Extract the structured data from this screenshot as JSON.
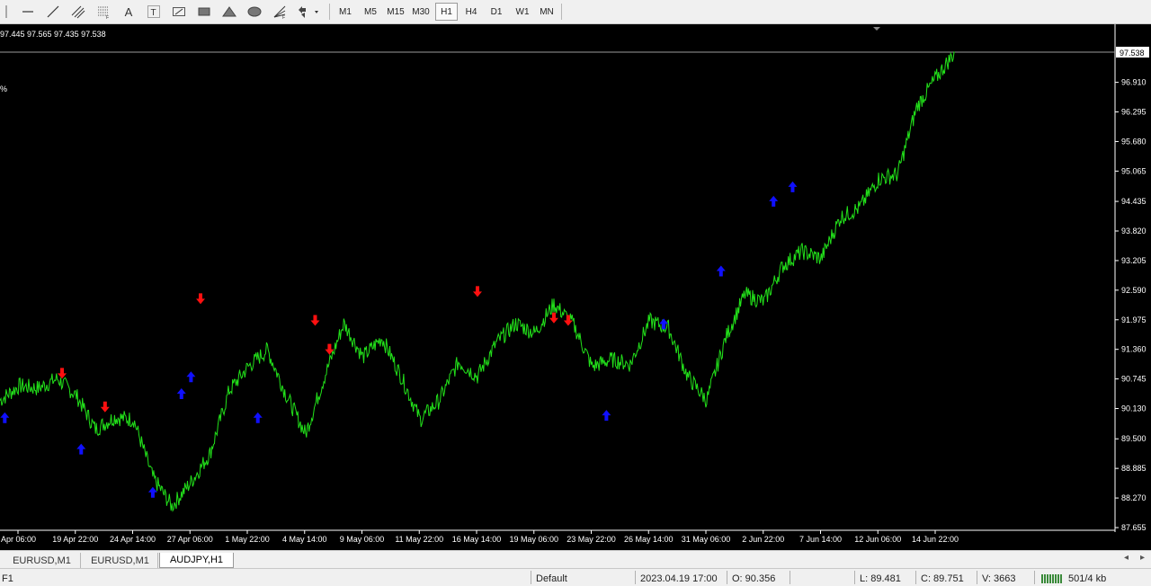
{
  "toolbar": {
    "tools": [
      {
        "name": "horizontal-line-icon"
      },
      {
        "name": "trend-line-icon"
      },
      {
        "name": "equidistant-channel-icon"
      },
      {
        "name": "fibonacci-icon"
      },
      {
        "name": "text-icon",
        "glyph": "A"
      },
      {
        "name": "text-label-icon",
        "glyph": "T"
      },
      {
        "name": "arrow-icon"
      },
      {
        "name": "rectangle-icon"
      },
      {
        "name": "triangle-icon"
      },
      {
        "name": "ellipse-icon"
      },
      {
        "name": "fibo-fan-icon"
      },
      {
        "name": "arrows-dropdown-icon"
      }
    ],
    "timeframes": [
      "M1",
      "M5",
      "M15",
      "M30",
      "H1",
      "H4",
      "D1",
      "W1",
      "MN"
    ],
    "active_timeframe": "H1"
  },
  "chart": {
    "ohlc_text": "97.445 97.565 97.435 97.538",
    "percent_text": "%",
    "current_price": "97.538",
    "colors": {
      "background": "#000000",
      "line": "#22e01a",
      "up_arrow": "#1010ff",
      "down_arrow": "#ff1010",
      "axis": "#ffffff"
    }
  },
  "chart_data": {
    "type": "line",
    "price_ticks": [
      "97.538",
      "96.910",
      "96.295",
      "95.680",
      "95.065",
      "94.435",
      "93.820",
      "93.205",
      "92.590",
      "91.975",
      "91.360",
      "90.745",
      "90.130",
      "89.500",
      "88.885",
      "88.270",
      "87.655"
    ],
    "time_ticks": [
      "Apr 06:00",
      "19 Apr 22:00",
      "24 Apr 14:00",
      "27 Apr 06:00",
      "1 May 22:00",
      "4 May 14:00",
      "9 May 06:00",
      "11 May 22:00",
      "16 May 14:00",
      "19 May 06:00",
      "23 May 22:00",
      "26 May 14:00",
      "31 May 06:00",
      "2 Jun 22:00",
      "7 Jun 14:00",
      "12 Jun 06:00",
      "14 Jun 22:00"
    ],
    "ylim": [
      87.655,
      97.538
    ],
    "series": [
      {
        "x": [
          0,
          0.02,
          0.04,
          0.06,
          0.08,
          0.1,
          0.12,
          0.14,
          0.16,
          0.18,
          0.2,
          0.22,
          0.24,
          0.26,
          0.28,
          0.3,
          0.32,
          0.34,
          0.36,
          0.38,
          0.4,
          0.42,
          0.44,
          0.46,
          0.48,
          0.5,
          0.52,
          0.54,
          0.56,
          0.58,
          0.6,
          0.62,
          0.64,
          0.66,
          0.68,
          0.7,
          0.72,
          0.74,
          0.76,
          0.78,
          0.8,
          0.82,
          0.84,
          0.86,
          0.88,
          0.9,
          0.92,
          0.94,
          0.96,
          0.98,
          1.0
        ],
        "y": [
          90.3,
          90.6,
          90.55,
          90.75,
          90.4,
          89.7,
          89.95,
          89.9,
          88.7,
          88.1,
          88.6,
          89.2,
          90.5,
          91.0,
          91.35,
          90.4,
          89.6,
          90.8,
          91.9,
          91.2,
          91.6,
          90.8,
          89.9,
          90.3,
          91.1,
          90.8,
          91.5,
          91.9,
          91.7,
          92.3,
          91.9,
          91.0,
          91.15,
          91.05,
          91.95,
          91.8,
          90.8,
          90.3,
          91.6,
          92.5,
          92.35,
          93.1,
          93.4,
          93.25,
          94.1,
          94.3,
          94.9,
          95.0,
          96.4,
          97.0,
          97.538
        ]
      }
    ],
    "up_arrows": [
      [
        0.005,
        90.05
      ],
      [
        0.085,
        89.4
      ],
      [
        0.16,
        88.5
      ],
      [
        0.19,
        90.55
      ],
      [
        0.2,
        90.9
      ],
      [
        0.27,
        90.05
      ],
      [
        0.635,
        90.1
      ],
      [
        0.695,
        92.0
      ],
      [
        0.755,
        93.1
      ],
      [
        0.81,
        94.55
      ],
      [
        0.83,
        94.85
      ]
    ],
    "down_arrows": [
      [
        0.065,
        90.75
      ],
      [
        0.11,
        90.05
      ],
      [
        0.21,
        92.3
      ],
      [
        0.33,
        91.85
      ],
      [
        0.345,
        91.25
      ],
      [
        0.5,
        92.45
      ],
      [
        0.58,
        91.9
      ],
      [
        0.595,
        91.85
      ]
    ]
  },
  "tabs": [
    {
      "label": "EURUSD,M1",
      "active": false
    },
    {
      "label": "EURUSD,M1",
      "active": false
    },
    {
      "label": "AUDJPY,H1",
      "active": true
    }
  ],
  "status": {
    "help": "F1",
    "profile": "Default",
    "datetime": "2023.04.19 17:00",
    "open": "O: 90.356",
    "low": "L: 89.481",
    "close": "C: 89.751",
    "volume": "V: 3663",
    "traffic": "501/4 kb"
  }
}
